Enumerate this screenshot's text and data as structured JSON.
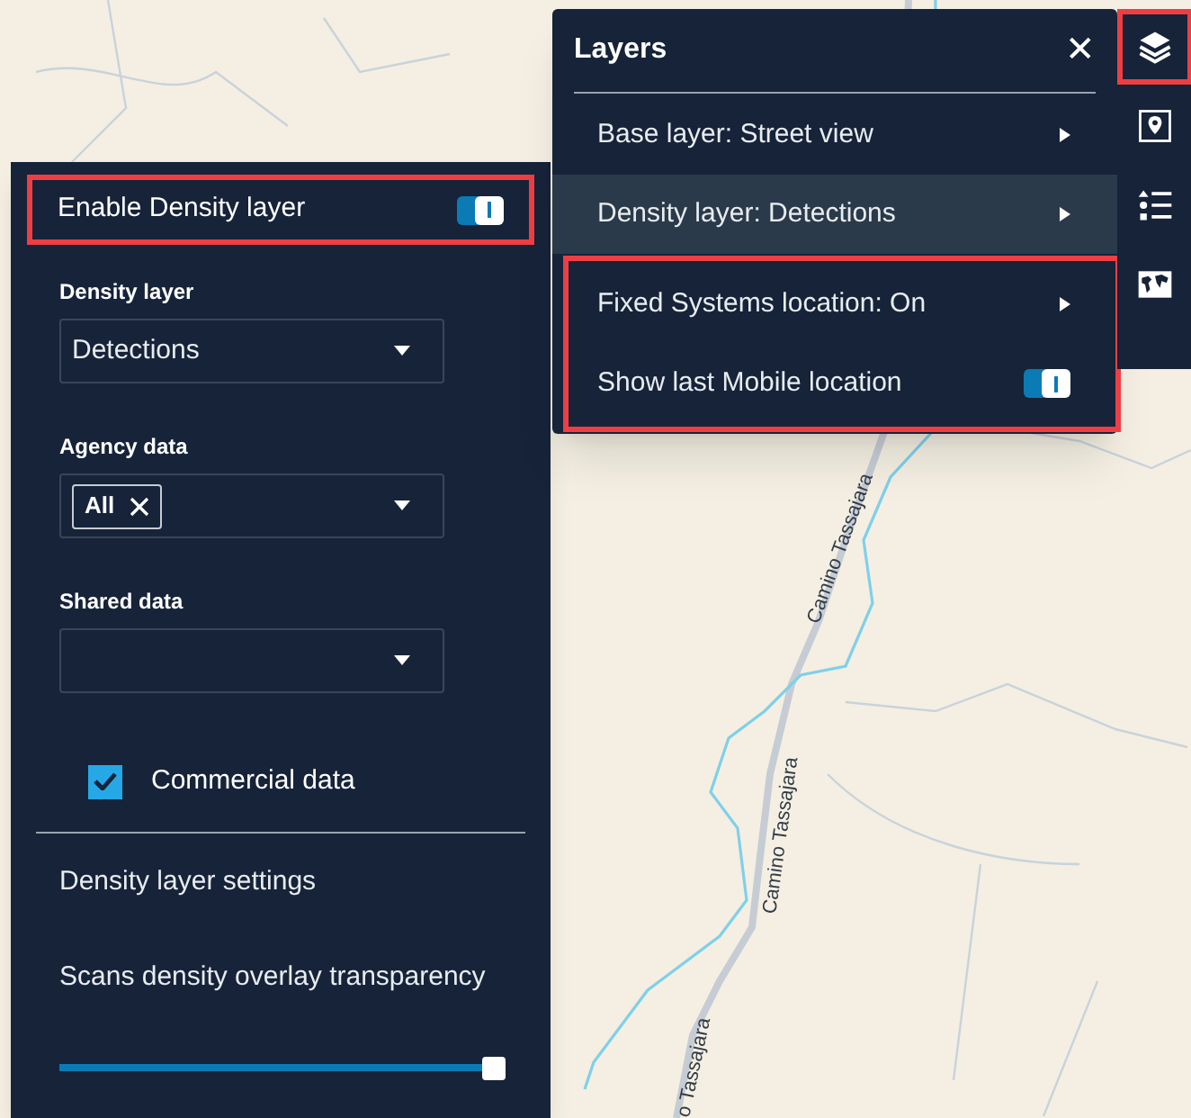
{
  "map": {
    "labels": [
      "Camino Tassajara",
      "Camino Tassajara",
      "o Tassajara"
    ]
  },
  "density_panel": {
    "enable": {
      "label": "Enable Density layer",
      "on": true,
      "highlighted": true
    },
    "fields": [
      {
        "label": "Density layer",
        "value": "Detections"
      },
      {
        "label": "Agency data",
        "chips": [
          "All"
        ]
      },
      {
        "label": "Shared data"
      }
    ],
    "commercial": {
      "label": "Commercial data",
      "checked": true
    },
    "settings_title": "Density layer settings",
    "slider": {
      "label": "Scans density overlay transparency",
      "level": 0.98
    }
  },
  "layers_popup": {
    "title": "Layers",
    "close": "✕",
    "items": [
      {
        "kind": "submenu",
        "label": "Base layer: Street view",
        "selected": false,
        "highlighted": false
      },
      {
        "kind": "submenu",
        "label": "Density layer: Detections",
        "selected": true,
        "highlighted": false
      },
      {
        "kind": "submenu",
        "label": "Fixed Systems location: On",
        "selected": false,
        "highlighted": true
      },
      {
        "kind": "toggle",
        "label": "Show last Mobile location",
        "on": true,
        "selected": false,
        "highlighted": true
      }
    ]
  },
  "toolbar": [
    {
      "kind": "layers",
      "highlighted": true
    },
    {
      "kind": "pin",
      "highlighted": false
    },
    {
      "kind": "list",
      "highlighted": false
    },
    {
      "kind": "worldmap",
      "highlighted": false
    }
  ]
}
